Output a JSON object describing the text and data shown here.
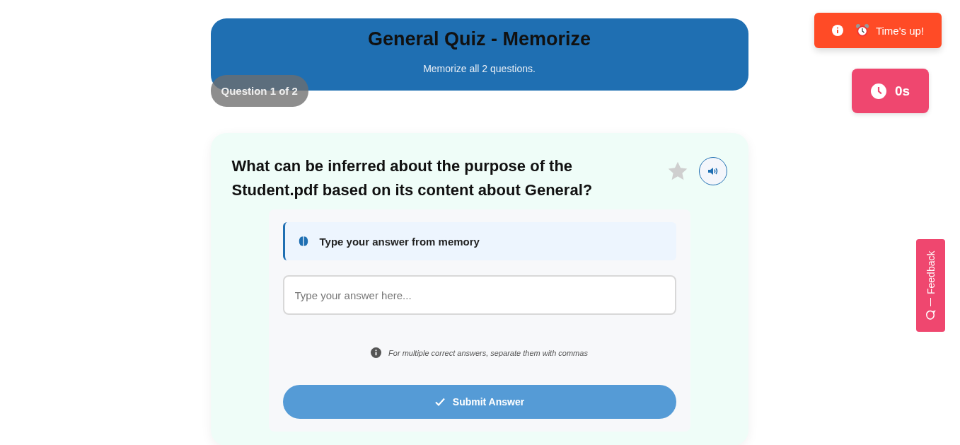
{
  "header": {
    "title": "General Quiz - Memorize",
    "subtitle": "Memorize all 2 questions."
  },
  "progress": {
    "label": "Question 1 of 2"
  },
  "toast": {
    "text": "Time's up!"
  },
  "timer": {
    "text": "0s"
  },
  "feedback_tab": {
    "label": "Feedback"
  },
  "question": {
    "text": "What can be inferred about the purpose of the Student.pdf based on its content about General?",
    "starred": false
  },
  "hint": {
    "text": "Type your answer from memory"
  },
  "answer": {
    "placeholder": "Type your answer here..."
  },
  "note": {
    "text": "For multiple correct answers, separate them with commas"
  },
  "submit": {
    "label": "Submit Answer",
    "disabled": true
  }
}
